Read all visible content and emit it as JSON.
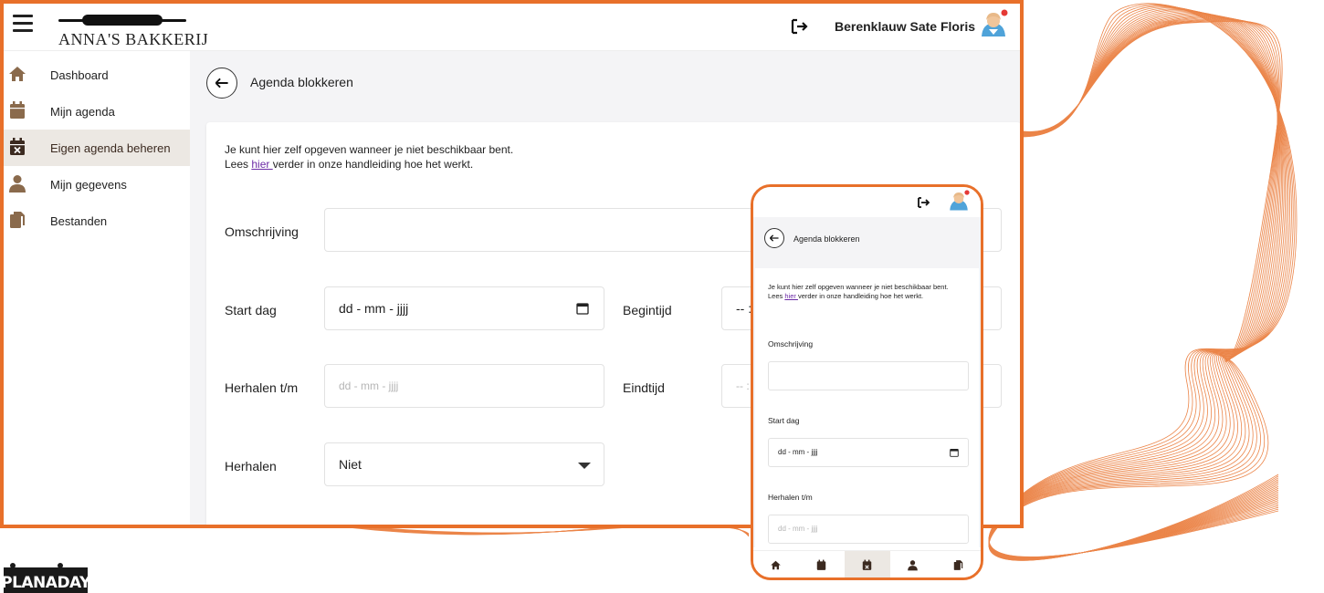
{
  "app": {
    "logo_text": "ANNA'S BAKKERIJ",
    "user_name": "Berenklauw Sate Floris"
  },
  "sidebar": {
    "items": [
      {
        "label": "Dashboard",
        "icon": "home-icon"
      },
      {
        "label": "Mijn agenda",
        "icon": "calendar-icon"
      },
      {
        "label": "Eigen agenda beheren",
        "icon": "calendar-x-icon",
        "active": true
      },
      {
        "label": "Mijn gegevens",
        "icon": "user-icon"
      },
      {
        "label": "Bestanden",
        "icon": "files-icon"
      }
    ]
  },
  "page": {
    "title": "Agenda blokkeren",
    "intro_line1": "Je kunt hier zelf opgeven wanneer je niet beschikbaar bent.",
    "intro_line2_prefix": "Lees ",
    "intro_link": "hier ",
    "intro_line2_suffix": "verder in onze handleiding hoe het werkt."
  },
  "form": {
    "omschrijving_label": "Omschrijving",
    "startdag_label": "Start dag",
    "startdag_value": "dd - mm - jjjj",
    "begintijd_label": "Begintijd",
    "begintijd_value": "-- : --",
    "herhalen_tm_label": "Herhalen t/m",
    "herhalen_tm_placeholder": "dd - mm - jjjj",
    "eindtijd_label": "Eindtijd",
    "eindtijd_value": "-- : --",
    "herhalen_label": "Herhalen",
    "herhalen_value": "Niet"
  },
  "mobile": {
    "title": "Agenda blokkeren",
    "intro_line1": "Je kunt hier zelf opgeven wanneer je niet beschikbaar bent.",
    "intro_line2_prefix": "Lees ",
    "intro_link": "hier ",
    "intro_line2_suffix": "verder in onze handleiding hoe het werkt.",
    "omschrijving_label": "Omschrijving",
    "startdag_label": "Start dag",
    "startdag_value": "dd - mm - jjjj",
    "herhalen_tm_label": "Herhalen t/m",
    "herhalen_tm_placeholder": "dd - mm - jjjj"
  },
  "brand": {
    "name": "PLANADAY"
  },
  "colors": {
    "accent": "#e8702a",
    "icon_brown": "#8a6a4c",
    "active_bg": "#ece8e3",
    "link": "#6b2aa5"
  }
}
